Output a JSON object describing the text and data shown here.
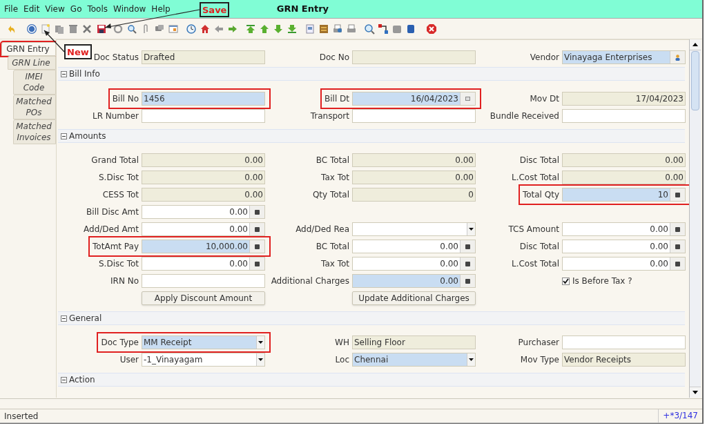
{
  "window": {
    "title": "GRN Entry"
  },
  "menu": [
    "File",
    "Edit",
    "View",
    "Go",
    "Tools",
    "Window",
    "Help"
  ],
  "annotations": [
    {
      "text": "Save"
    },
    {
      "text": "New"
    }
  ],
  "tabs": [
    {
      "label": "GRN Entry",
      "selected": true,
      "highlighted": true
    },
    {
      "label": "GRN Line",
      "selected": false,
      "highlighted": false
    },
    {
      "label": "IMEI Code",
      "selected": false,
      "highlighted": false
    },
    {
      "label": "Matched POs",
      "selected": false,
      "highlighted": false
    },
    {
      "label": "Matched Invoices",
      "selected": false,
      "highlighted": false
    }
  ],
  "header_row": [
    {
      "label": "Doc Status",
      "value": "Drafted",
      "kind": "text",
      "readonly": true,
      "mandatory": false,
      "highlighted": false
    },
    {
      "label": "Doc No",
      "kind": "text",
      "readonly": true,
      "mandatory": false,
      "highlighted": false
    },
    {
      "label": "Vendor",
      "value": "Vinayaga Enterprises",
      "kind": "lookup",
      "readonly": false,
      "mandatory": true,
      "highlighted": false
    }
  ],
  "sections": [
    {
      "title": "Bill Info",
      "expanded": true,
      "rows": [
        [
          {
            "label": "Bill No",
            "value": "1456",
            "kind": "text",
            "readonly": false,
            "mandatory": true,
            "highlighted": true
          },
          {
            "label": "Bill Dt",
            "value": "16/04/2023",
            "kind": "date",
            "readonly": false,
            "mandatory": true,
            "highlighted": true
          },
          {
            "label": "Mov Dt",
            "value": "17/04/2023",
            "kind": "number",
            "readonly": true,
            "mandatory": false,
            "highlighted": false
          }
        ],
        [
          {
            "label": "LR Number",
            "kind": "text",
            "readonly": false,
            "mandatory": false,
            "highlighted": false
          },
          {
            "label": "Transport",
            "kind": "text",
            "readonly": false,
            "mandatory": false,
            "highlighted": false
          },
          {
            "label": "Bundle Received",
            "kind": "text",
            "readonly": false,
            "mandatory": false,
            "highlighted": false
          }
        ]
      ]
    },
    {
      "title": "Amounts",
      "expanded": true,
      "rows": [
        [
          {
            "label": "Grand Total",
            "value": "0.00",
            "kind": "number",
            "readonly": true,
            "mandatory": false,
            "highlighted": false
          },
          {
            "label": "BC Total",
            "value": "0.00",
            "kind": "number",
            "readonly": true,
            "mandatory": false,
            "highlighted": false
          },
          {
            "label": "Disc Total",
            "value": "0.00",
            "kind": "number",
            "readonly": true,
            "mandatory": false,
            "highlighted": false
          }
        ],
        [
          {
            "label": "S.Disc Tot",
            "value": "0.00",
            "kind": "number",
            "readonly": true,
            "mandatory": false,
            "highlighted": false
          },
          {
            "label": "Tax Tot",
            "value": "0.00",
            "kind": "number",
            "readonly": true,
            "mandatory": false,
            "highlighted": false
          },
          {
            "label": "L.Cost Total",
            "value": "0.00",
            "kind": "number",
            "readonly": true,
            "mandatory": false,
            "highlighted": false
          }
        ],
        [
          {
            "label": "CESS Tot",
            "value": "0.00",
            "kind": "number",
            "readonly": true,
            "mandatory": false,
            "highlighted": false
          },
          {
            "label": "Qty Total",
            "value": "0",
            "kind": "number",
            "readonly": true,
            "mandatory": false,
            "highlighted": false
          },
          {
            "label": "Total Qty",
            "value": "10",
            "kind": "amount",
            "readonly": false,
            "mandatory": true,
            "highlighted": true
          }
        ],
        [
          {
            "label": "Bill Disc Amt",
            "value": "0.00",
            "kind": "amount",
            "readonly": false,
            "mandatory": false,
            "highlighted": false
          },
          null,
          null
        ],
        [
          {
            "label": "Add/Ded Amt",
            "value": "0.00",
            "kind": "amount",
            "readonly": false,
            "mandatory": false,
            "highlighted": false
          },
          {
            "label": "Add/Ded Rea",
            "kind": "dropdown",
            "readonly": false,
            "mandatory": false,
            "highlighted": false
          },
          {
            "label": "TCS Amount",
            "value": "0.00",
            "kind": "amount",
            "readonly": false,
            "mandatory": false,
            "highlighted": false
          }
        ],
        [
          {
            "label": "TotAmt Pay",
            "value": "10,000.00",
            "kind": "amount",
            "readonly": false,
            "mandatory": true,
            "highlighted": true
          },
          {
            "label": "BC Total",
            "value": "0.00",
            "kind": "amount",
            "readonly": false,
            "mandatory": false,
            "highlighted": false
          },
          {
            "label": "Disc Total",
            "value": "0.00",
            "kind": "amount",
            "readonly": false,
            "mandatory": false,
            "highlighted": false
          }
        ],
        [
          {
            "label": "S.Disc Tot",
            "value": "0.00",
            "kind": "amount",
            "readonly": false,
            "mandatory": false,
            "highlighted": false
          },
          {
            "label": "Tax Tot",
            "value": "0.00",
            "kind": "amount",
            "readonly": false,
            "mandatory": false,
            "highlighted": false
          },
          {
            "label": "L.Cost Total",
            "value": "0.00",
            "kind": "amount",
            "readonly": false,
            "mandatory": false,
            "highlighted": false
          }
        ],
        [
          {
            "label": "IRN No",
            "kind": "text",
            "readonly": false,
            "mandatory": false,
            "highlighted": false
          },
          {
            "label": "Additional Charges",
            "value": "0.00",
            "kind": "amount",
            "readonly": false,
            "mandatory": true,
            "highlighted": false
          },
          {
            "value": "Is Before Tax ?",
            "kind": "checkbox",
            "checked": true,
            "highlighted": false
          }
        ],
        [
          {
            "value": "Apply Discount Amount",
            "kind": "button",
            "highlighted": false
          },
          {
            "value": "Update Additional Charges",
            "kind": "button",
            "highlighted": false
          },
          null
        ]
      ]
    },
    {
      "title": "General",
      "expanded": true,
      "rows": [
        [
          {
            "label": "Doc Type",
            "value": "MM Receipt",
            "kind": "dropdown",
            "readonly": false,
            "mandatory": true,
            "highlighted": true
          },
          {
            "label": "WH",
            "value": "Selling Floor",
            "kind": "text",
            "readonly": true,
            "mandatory": false,
            "highlighted": false
          },
          {
            "label": "Purchaser",
            "kind": "text",
            "readonly": false,
            "mandatory": false,
            "highlighted": false
          }
        ],
        [
          {
            "label": "User",
            "value": "-1_Vinayagam",
            "kind": "dropdown",
            "readonly": false,
            "mandatory": false,
            "highlighted": false
          },
          {
            "label": "Loc",
            "value": "Chennai",
            "kind": "dropdown",
            "readonly": false,
            "mandatory": true,
            "highlighted": false
          },
          {
            "label": "Mov Type",
            "value": "Vendor Receipts",
            "kind": "text",
            "readonly": true,
            "mandatory": false,
            "highlighted": false
          }
        ]
      ]
    },
    {
      "title": "Action",
      "expanded": true
    }
  ],
  "status_bar": {
    "message": "Inserted",
    "record": "+*3/147"
  }
}
